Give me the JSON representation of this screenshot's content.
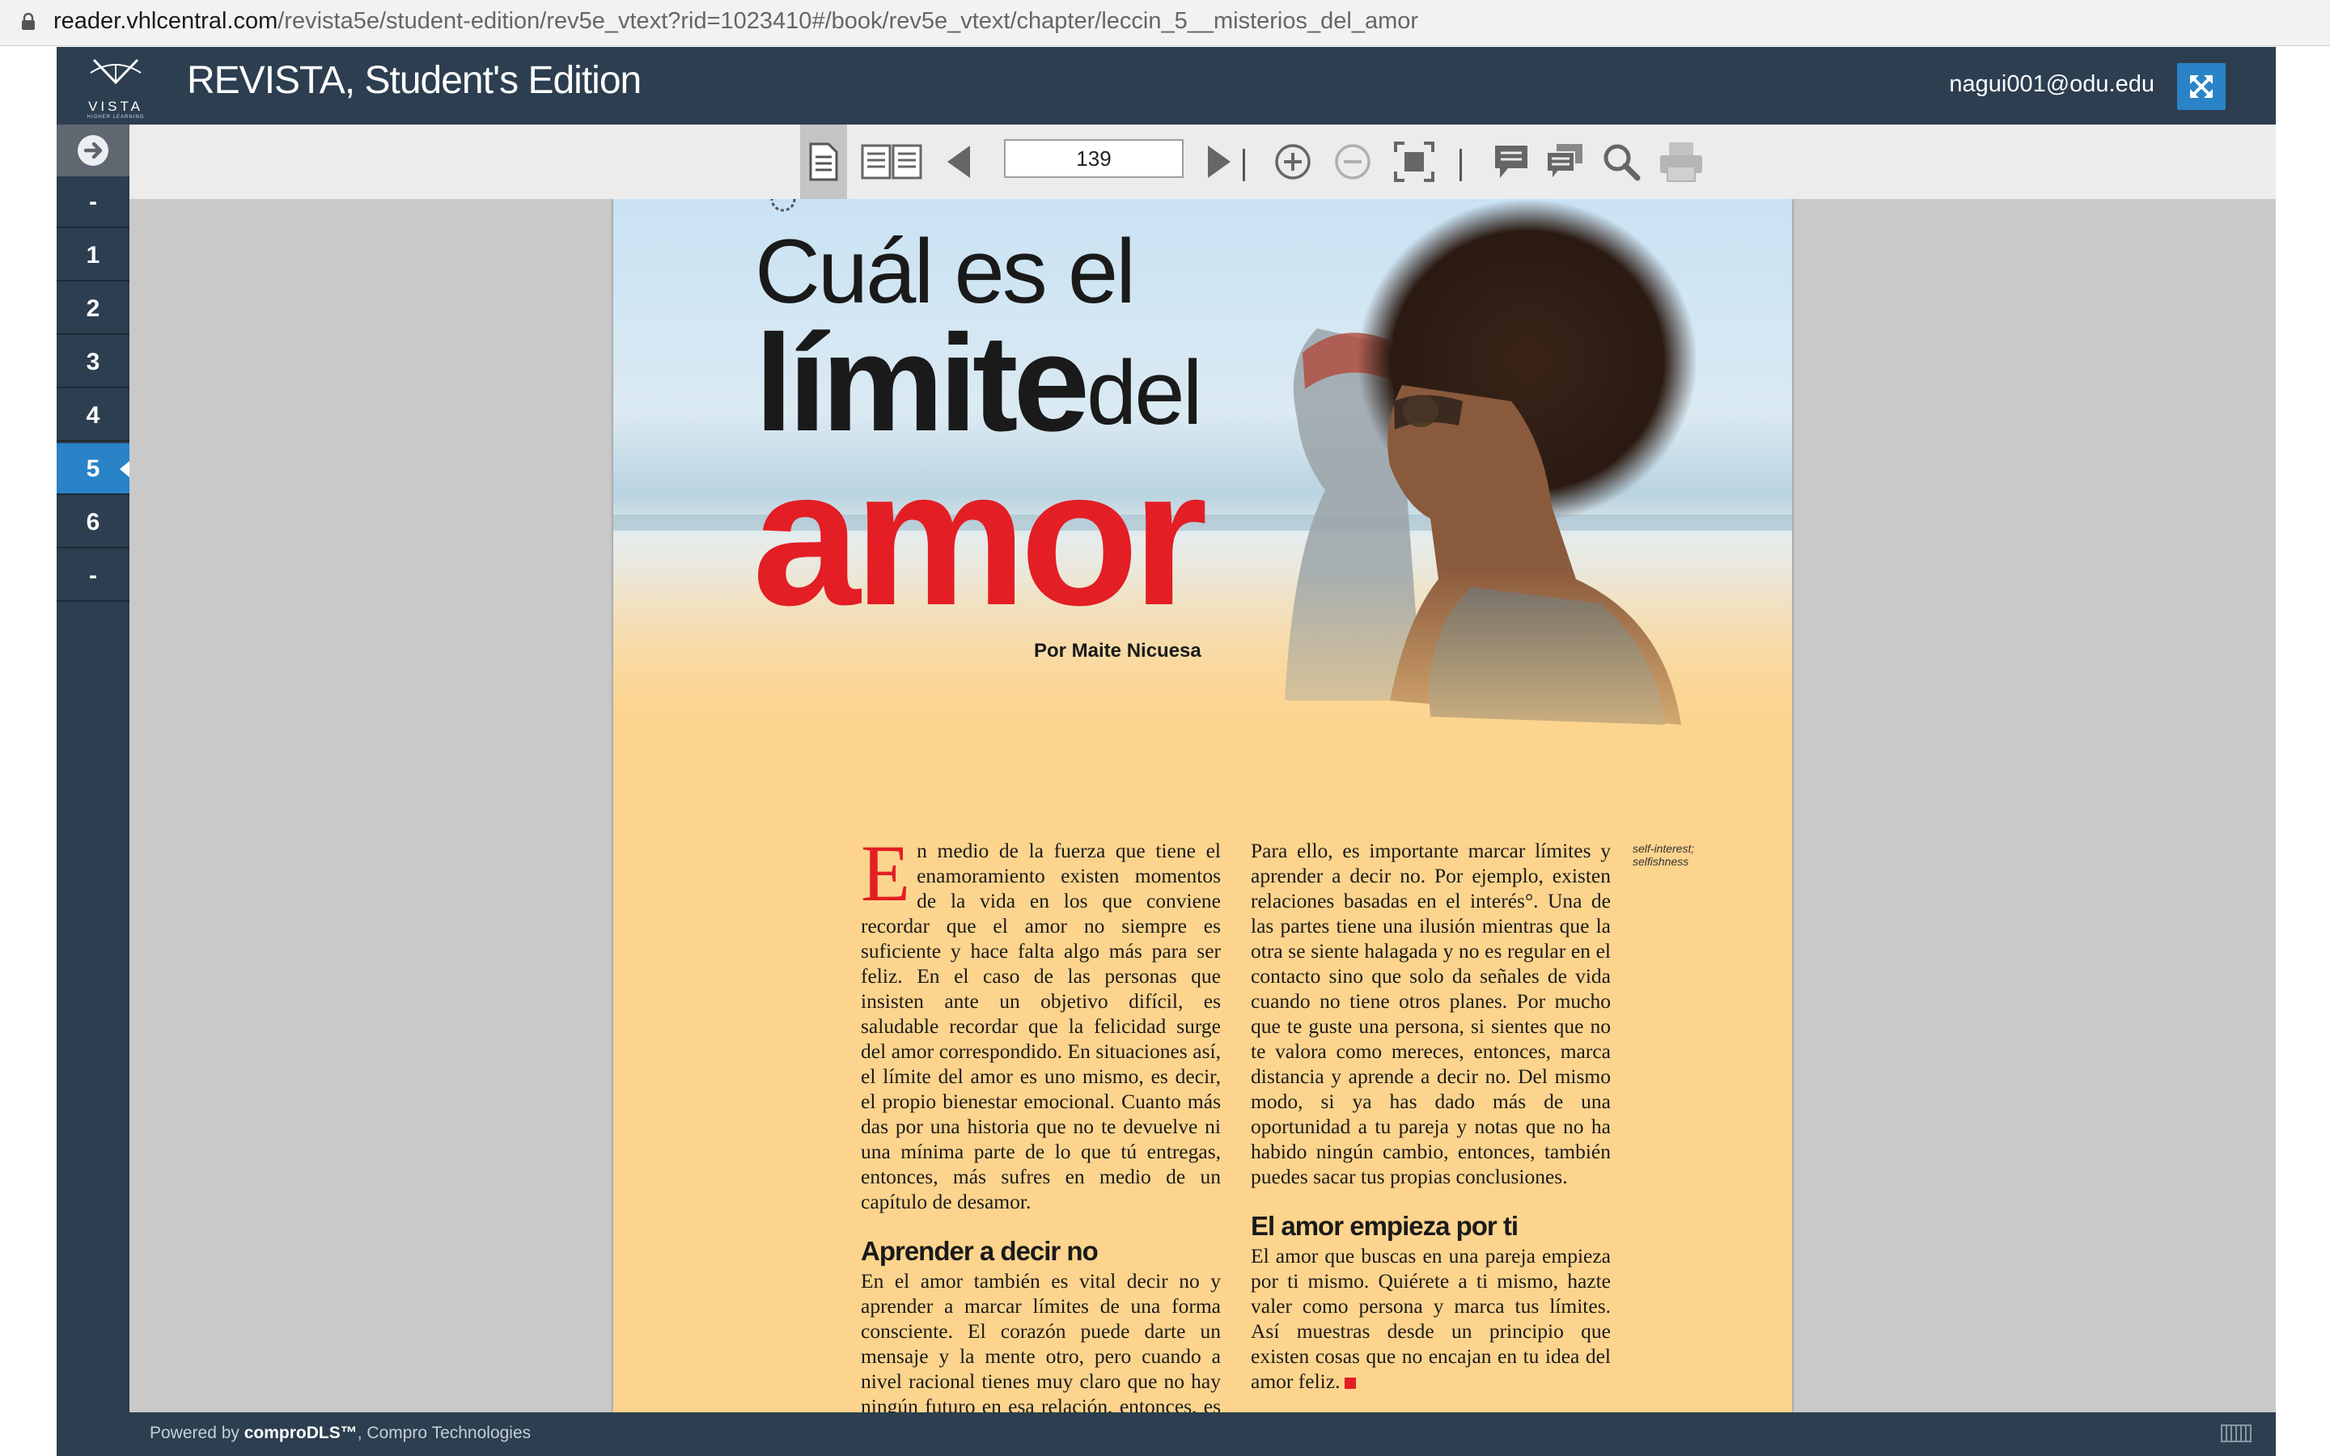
{
  "browser": {
    "url_host": "reader.vhlcentral.com",
    "url_path": "/revista5e/student-edition/rev5e_vtext?rid=1023410#/book/rev5e_vtext/chapter/leccin_5__misterios_del_amor"
  },
  "header": {
    "logo_word": "VISTA",
    "logo_tagline": "HIGHER LEARNING",
    "title": "REVISTA, Student's Edition",
    "user_email": "nagui001@odu.edu"
  },
  "sidebar": {
    "chapters": [
      {
        "label": "-"
      },
      {
        "label": "1"
      },
      {
        "label": "2"
      },
      {
        "label": "3"
      },
      {
        "label": "4"
      },
      {
        "label": "5",
        "active": true
      },
      {
        "label": "6"
      },
      {
        "label": "-"
      }
    ]
  },
  "toolbar": {
    "page_number": "139"
  },
  "page": {
    "title_line1": "Cuál es el",
    "title_line2_bold": "límite",
    "title_line2_light": "del",
    "title_line3": "amor",
    "byline": "Por Maite Nicuesa",
    "col1_dropcap": "E",
    "col1_para1": "n medio de la fuerza que tiene el enamoramiento existen momentos de la vida en los que conviene recordar que el amor no siempre es suficiente y hace falta algo más para ser feliz. En el caso de las personas que insisten ante un objetivo difícil, es saludable recordar que la felicidad surge del amor correspondido. En situaciones así, el límite del amor es uno mismo, es decir, el propio bienestar emocional. Cuanto más das por una historia que no te devuelve ni una mínima parte de lo que tú entregas, entonces, más sufres en medio de un capítulo de desamor.",
    "subhead1": "Aprender a decir no",
    "col1_para2": "En el amor también es vital decir no y aprender a marcar límites de una forma consciente. El corazón puede darte un mensaje y la mente otro, pero cuando a nivel racional tienes muy claro que no hay ningún futuro en esa relación, entonces, es vital que te protejas de verdad a ti mismo de decepciones posteriores.",
    "col2_para1": "Para ello, es importante marcar límites y aprender a decir no. Por ejemplo, existen relaciones basadas en el interés°. Una de las partes tiene una ilusión mientras que la otra se siente halagada y no es regular en el contacto sino que solo da señales de vida cuando no tiene otros planes. Por mucho que te guste una persona, si sientes que no te valora como mereces, entonces, marca distancia y aprende a decir no. Del mismo modo, si ya has dado más de una oportunidad a tu pareja y notas que no ha habido ningún cambio, entonces, también puedes sacar tus propias conclusiones.",
    "subhead2": "El amor empieza por ti",
    "col2_para2": "El amor que buscas en una pareja empieza por ti mismo. Quiérete a ti mismo, hazte valer como persona y marca tus límites. Así muestras desde un principio que existen cosas que no encajan en tu idea del amor feliz.",
    "gloss_line1": "self-interest;",
    "gloss_line2": "selfishness"
  },
  "footer": {
    "powered_prefix": "Powered by ",
    "powered_brand": "comproDLS™",
    "powered_suffix": ", Compro Technologies"
  },
  "colors": {
    "header_bg": "#2c3e50",
    "accent_blue": "#2a83c7",
    "title_red": "#e31e24",
    "page_yellow": "#fdd48d"
  },
  "icons": [
    "lock-icon",
    "vista-logo",
    "fullscreen-icon",
    "arrow-right-circle-icon",
    "single-page-icon",
    "double-page-icon",
    "prev-page-icon",
    "next-page-icon",
    "zoom-in-icon",
    "zoom-out-icon",
    "fit-page-icon",
    "note-icon",
    "notes-list-icon",
    "search-icon",
    "print-icon",
    "book-icon"
  ]
}
